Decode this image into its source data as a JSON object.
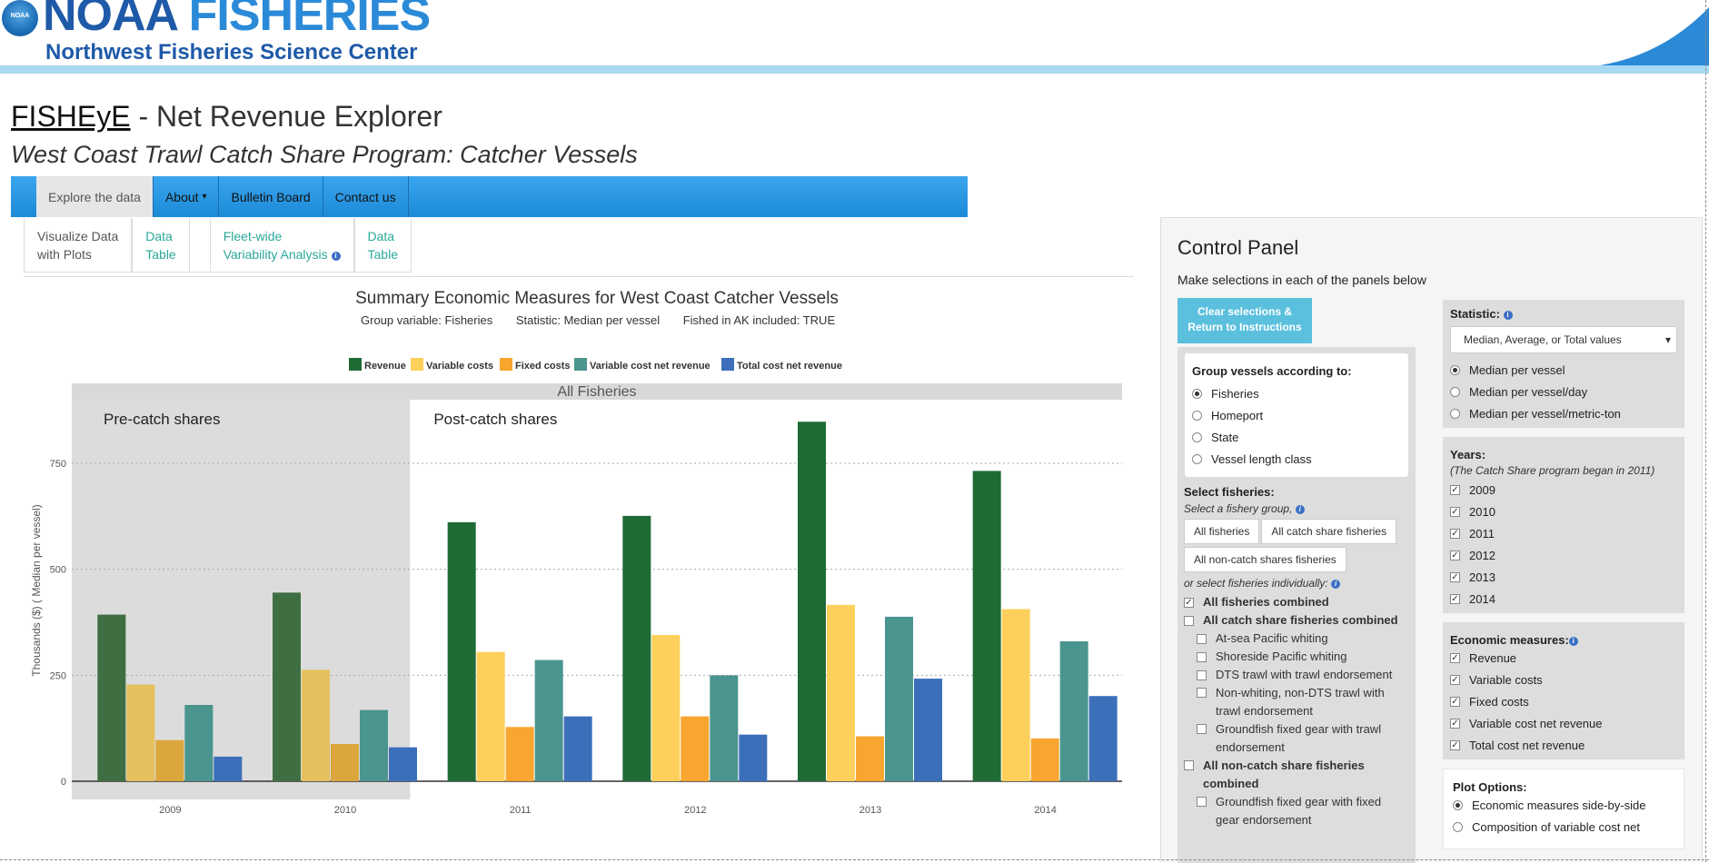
{
  "header": {
    "logo_badge": "NOAA",
    "org_name_1": "NOAA",
    "org_name_2": "FISHERIES",
    "center_name": "Northwest Fisheries Science Center"
  },
  "app": {
    "brand": "FISHEyE",
    "title_rest": " - Net Revenue Explorer",
    "subtitle": "West Coast Trawl Catch Share Program: Catcher Vessels"
  },
  "nav": {
    "items": [
      "Explore the data",
      "About",
      "Bulletin Board",
      "Contact us"
    ],
    "about_caret": "▾"
  },
  "subtabs": {
    "visualize_1": "Visualize Data",
    "visualize_2": "with Plots",
    "table_1": "Data",
    "table_2": "Table",
    "fleet_1": "Fleet-wide",
    "fleet_2": "Variability Analysis",
    "table2_1": "Data",
    "table2_2": "Table",
    "info": "i"
  },
  "chart_header": {
    "title": "Summary Economic Measures for West Coast Catcher Vessels",
    "group_variable": "Group variable: Fisheries",
    "statistic": "Statistic:  Median per vessel",
    "fished_ak": "Fished in AK included: TRUE"
  },
  "chart_data": {
    "type": "bar",
    "facet_label": "All Fisheries",
    "period_labels": [
      "Pre-catch shares",
      "Post-catch shares"
    ],
    "pre_period_categories": [
      "2009",
      "2010"
    ],
    "categories": [
      "2009",
      "2010",
      "2011",
      "2012",
      "2013",
      "2014"
    ],
    "ylabel": "Thousands ($) ( Median per vessel)",
    "xlabel": "",
    "ylim": [
      0,
      900
    ],
    "yticks": [
      0,
      250,
      500,
      750
    ],
    "grid": true,
    "legend_position": "top",
    "series": [
      {
        "name": "Revenue",
        "color": "#1e6b35",
        "pre_color": "#3f6e42",
        "values": [
          393,
          445,
          611,
          626,
          848,
          732
        ]
      },
      {
        "name": "Variable costs",
        "color": "#fdd05b",
        "pre_color": "#e4c05e",
        "values": [
          228,
          263,
          305,
          345,
          416,
          406
        ]
      },
      {
        "name": "Fixed costs",
        "color": "#f8a630",
        "pre_color": "#dba73c",
        "values": [
          97,
          88,
          128,
          153,
          106,
          101
        ]
      },
      {
        "name": "Variable cost net revenue",
        "color": "#4a958e",
        "pre_color": "#4a958e",
        "values": [
          180,
          168,
          286,
          250,
          388,
          330
        ]
      },
      {
        "name": "Total cost net revenue",
        "color": "#3c6fba",
        "pre_color": "#3c6fba",
        "values": [
          58,
          80,
          153,
          110,
          242,
          201
        ]
      }
    ]
  },
  "control_panel": {
    "title": "Control Panel",
    "hint": "Make selections in each of the panels below",
    "clear_button_1": "Clear selections &",
    "clear_button_2": "Return to Instructions",
    "group_label": "Group vessels according to:",
    "group_options": [
      "Fisheries",
      "Homeport",
      "State",
      "Vessel length class"
    ],
    "select_fisheries_label": "Select fisheries:",
    "select_group_hint": "Select a fishery group,",
    "group_buttons": [
      "All fisheries",
      "All catch share fisheries",
      "All non-catch shares fisheries"
    ],
    "individual_hint": "or select fisheries individually:",
    "fisheries": {
      "all_combined": "All fisheries combined",
      "catch_share_combined": "All catch share fisheries combined",
      "at_sea": "At-sea Pacific whiting",
      "shoreside": "Shoreside Pacific whiting",
      "dts": "DTS trawl with trawl endorsement",
      "non_whiting_1": "Non-whiting, non-DTS trawl with",
      "non_whiting_2": "trawl endorsement",
      "groundfish_trawl_1": "Groundfish fixed gear with trawl",
      "groundfish_trawl_2": "endorsement",
      "non_catch_1": "All non-catch share fisheries",
      "non_catch_2": "combined",
      "groundfish_fixed_1": "Groundfish fixed gear with fixed",
      "groundfish_fixed_2": "gear endorsement"
    },
    "statistic_label": "Statistic:",
    "statistic_select": "Median, Average, or Total values",
    "statistic_options": [
      "Median per vessel",
      "Median per vessel/day",
      "Median per vessel/metric-ton"
    ],
    "years_label": "Years:",
    "years_note": "(The Catch Share program began in 2011)",
    "years": [
      "2009",
      "2010",
      "2011",
      "2012",
      "2013",
      "2014"
    ],
    "measures_label": "Economic measures:",
    "measures": [
      "Revenue",
      "Variable costs",
      "Fixed costs",
      "Variable cost net revenue",
      "Total cost net revenue"
    ],
    "plot_options_label": "Plot Options:",
    "plot_options": [
      "Economic measures side-by-side",
      "Composition of variable cost net"
    ],
    "check_mark": "✓"
  }
}
